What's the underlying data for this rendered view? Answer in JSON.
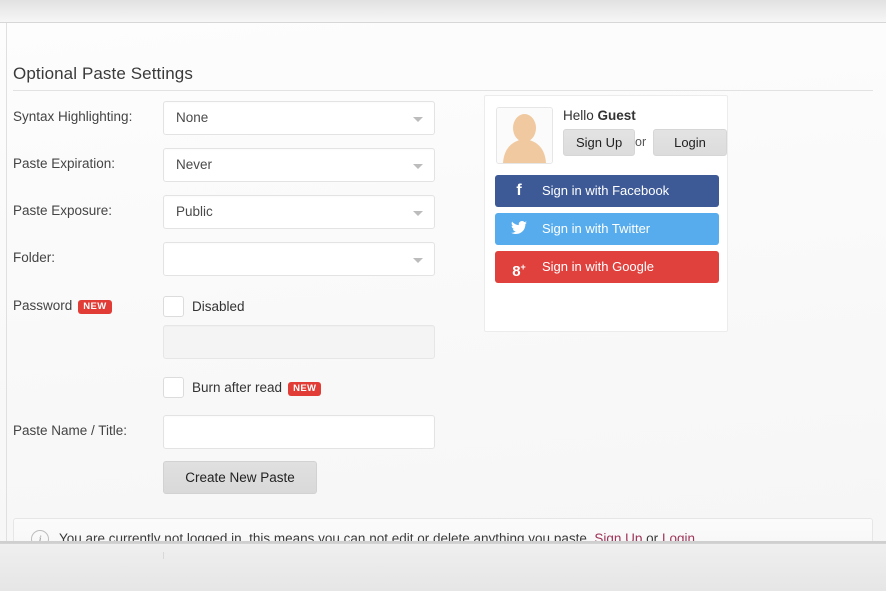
{
  "page": {
    "title": "Optional Paste Settings"
  },
  "form": {
    "rows": [
      {
        "label": "Syntax Highlighting:",
        "value": "None",
        "type": "select"
      },
      {
        "label": "Paste Expiration:",
        "value": "Never",
        "type": "select"
      },
      {
        "label": "Paste Exposure:",
        "value": "Public",
        "type": "select"
      },
      {
        "label": "Folder:",
        "value": "",
        "type": "select"
      }
    ],
    "password": {
      "label": "Password",
      "badge": "NEW",
      "disabled_checkbox_label": "Disabled",
      "input_value": "",
      "input_placeholder": ""
    },
    "burn": {
      "label": "Burn after read",
      "badge": "NEW"
    },
    "paste_name": {
      "label": "Paste Name / Title:",
      "value": "",
      "placeholder": ""
    },
    "submit_label": "Create New Paste"
  },
  "login_card": {
    "greeting_prefix": "Hello ",
    "greeting_name": "Guest",
    "signup_label": "Sign Up",
    "or_label": "or",
    "login_label": "Login",
    "social": [
      {
        "id": "facebook",
        "label": "Sign in with Facebook",
        "icon": "f",
        "color": "#3d5a97"
      },
      {
        "id": "twitter",
        "label": "Sign in with Twitter",
        "icon": "🐦",
        "color": "#56aced"
      },
      {
        "id": "google",
        "label": "Sign in with Google",
        "icon": "8⁺",
        "color": "#e0413d"
      }
    ]
  },
  "alert": {
    "icon": "i",
    "text": "You are currently not logged in, this means you can not edit or delete anything you paste.",
    "link_signup": "Sign Up",
    "link_or": "or",
    "link_login": "Login",
    "link_color": "#9e3457"
  }
}
